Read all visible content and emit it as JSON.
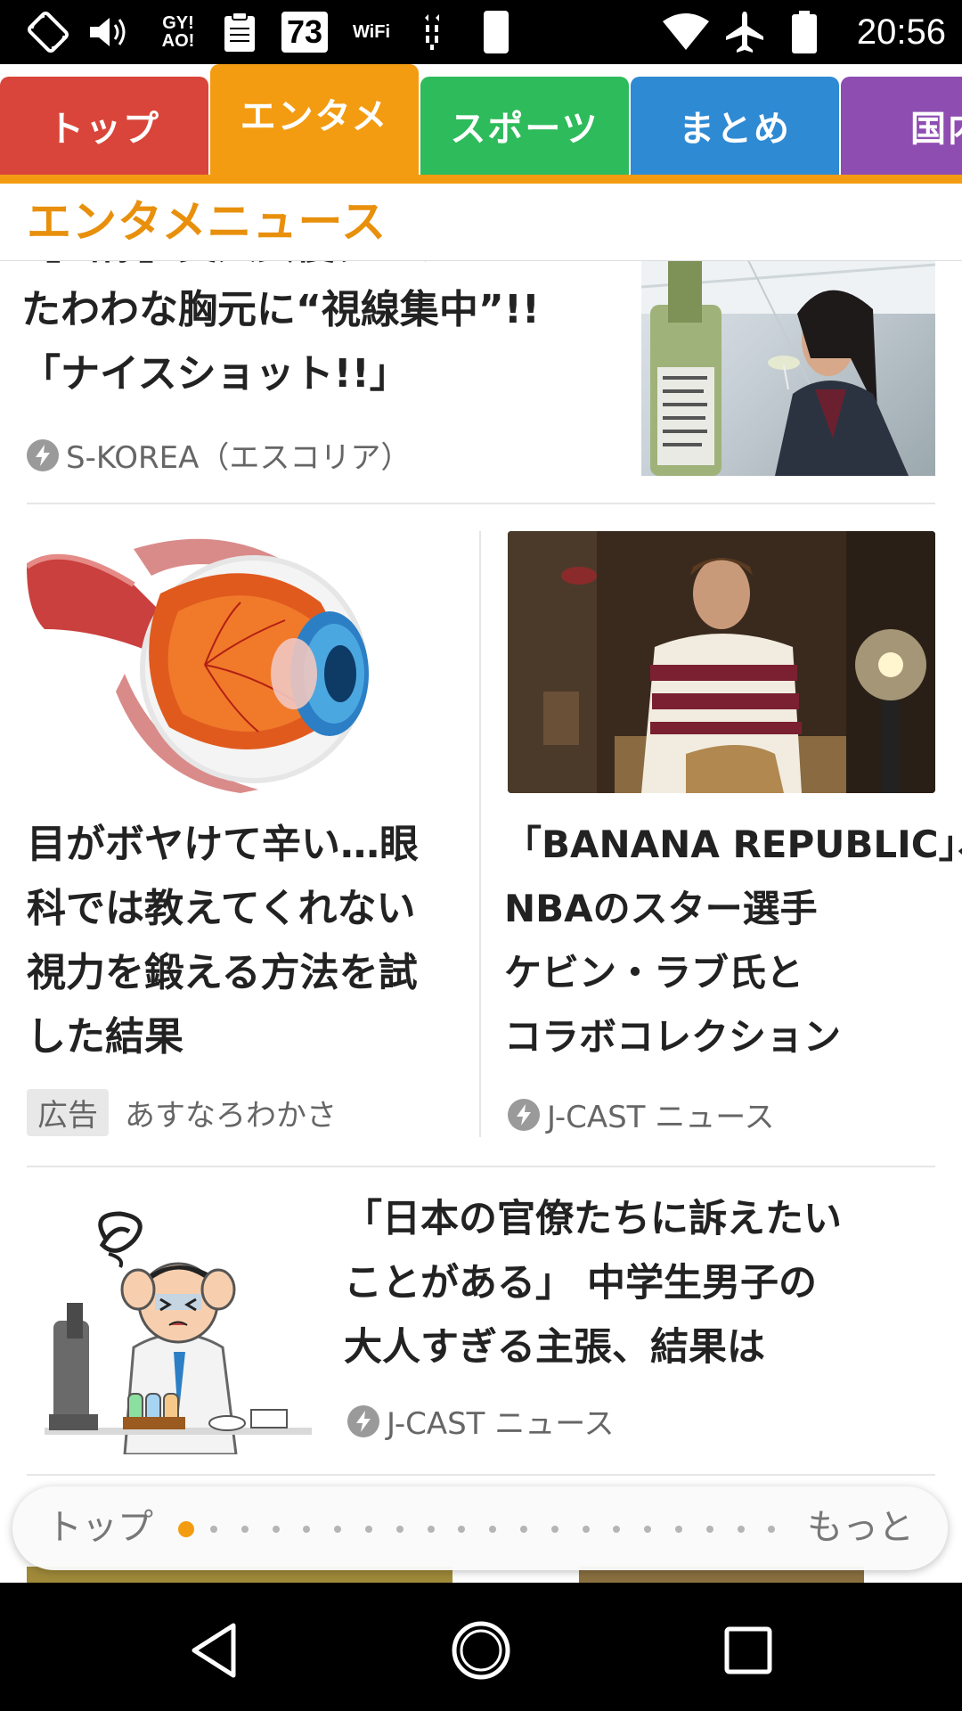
{
  "status_bar": {
    "time": "20:56",
    "notif_gyao": "GY!\nAO!",
    "notif_73": "73",
    "notif_wifi_label": "WiFi",
    "icons": [
      "rotate-icon",
      "volume-icon",
      "gyao-icon",
      "clipboard-icon",
      "badge-73-icon",
      "wifi-app-icon",
      "usb-icon",
      "moon-icon",
      "wifi-signal-icon",
      "airplane-icon",
      "battery-icon"
    ]
  },
  "tabs": [
    {
      "label": "トップ",
      "color": "#d9453a",
      "active": false
    },
    {
      "label": "エンタメ",
      "color": "#f39c12",
      "active": true
    },
    {
      "label": "スポーツ",
      "color": "#2ebb5b",
      "active": false
    },
    {
      "label": "まとめ",
      "color": "#2f8ad4",
      "active": false
    },
    {
      "label": "国内",
      "color": "#8e4db0",
      "active": false
    }
  ],
  "section": {
    "title": "エンタメニュース"
  },
  "articles": [
    {
      "headline_lines": [
        "【画像】美人女優ダンテの",
        "たわわな胸元に“視線集中”!!",
        "「ナイスショット!!」"
      ],
      "source": "S-KOREA（エスコリア）",
      "image": "woman-with-wine-photo"
    },
    {
      "headline_lines": [
        "目がボヤけて辛い…眼",
        "科では教えてくれない",
        "視力を鍛える方法を試",
        "した結果"
      ],
      "ad_label": "広告",
      "source": "あすなろわかさ",
      "image": "eyeball-illustration"
    },
    {
      "headline_lines": [
        "「BANANA REPUBLIC」、",
        "NBAのスター選手",
        "ケビン・ラブ氏と",
        "コラボコレクション"
      ],
      "source": "J-CAST ニュース",
      "image": "man-in-sweater-photo"
    },
    {
      "headline_lines": [
        "「日本の官僚たちに訴えたい",
        "ことがある」 中学生男子の",
        "大人すぎる主張、結果は"
      ],
      "source": "J-CAST ニュース",
      "image": "confused-scientist-illustration"
    }
  ],
  "pager": {
    "left_label": "トップ",
    "right_label": "もっと",
    "page_count": 20,
    "active_index": 0
  },
  "nav_bar": {
    "buttons": [
      "back",
      "home",
      "recents"
    ]
  },
  "colors": {
    "accent": "#f39c12",
    "title": "#e8900c"
  }
}
